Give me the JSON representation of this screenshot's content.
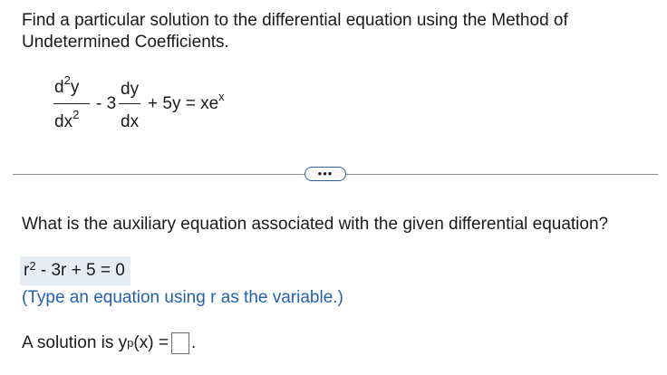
{
  "prompt": {
    "line1": "Find a particular solution to the differential equation using the Method of",
    "line2": "Undetermined Coefficients."
  },
  "equation": {
    "num1": "d",
    "num1_sup": "2",
    "num1_var": "y",
    "den1": "dx",
    "den1_sup": "2",
    "op1": "- 3",
    "num2": "dy",
    "den2": "dx",
    "rest": "+ 5y = xe",
    "rest_sup": "x"
  },
  "more_button": {
    "label": "•••"
  },
  "question": {
    "text": "What is the auxiliary equation associated with the given differential equation?"
  },
  "answer": {
    "var": "r",
    "sup": "2",
    "rest": " - 3r + 5 = 0"
  },
  "hint": {
    "text": "(Type an equation using r as the variable.)"
  },
  "solution": {
    "prefix": "A solution is y",
    "sub": "p",
    "suffix": "(x) =",
    "end": "."
  }
}
